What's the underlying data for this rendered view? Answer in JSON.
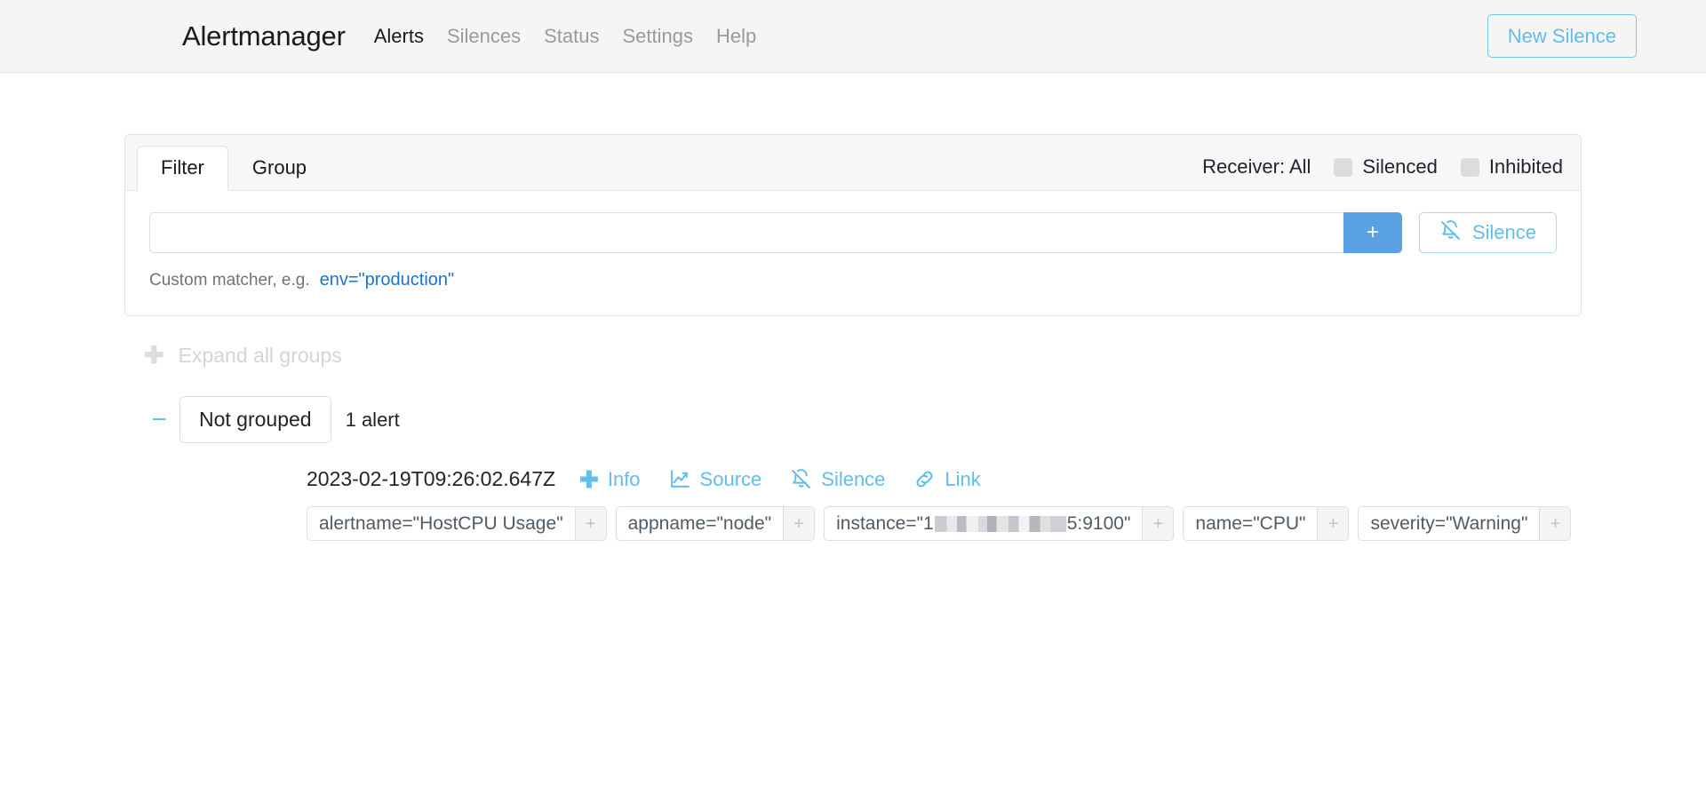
{
  "navbar": {
    "brand": "Alertmanager",
    "links": [
      {
        "label": "Alerts",
        "active": true
      },
      {
        "label": "Silences",
        "active": false
      },
      {
        "label": "Status",
        "active": false
      },
      {
        "label": "Settings",
        "active": false
      },
      {
        "label": "Help",
        "active": false
      }
    ],
    "new_silence_label": "New Silence"
  },
  "filter_card": {
    "tabs": [
      {
        "label": "Filter",
        "active": true
      },
      {
        "label": "Group",
        "active": false
      }
    ],
    "receiver_label": "Receiver: All",
    "checkboxes": [
      {
        "label": "Silenced",
        "checked": false
      },
      {
        "label": "Inhibited",
        "checked": false
      }
    ],
    "matcher_input_value": "",
    "matcher_input_placeholder": "",
    "add_button_label": "+",
    "silence_button_label": "Silence",
    "silence_button_icon": "bell-slash-icon",
    "helper_text": "Custom matcher, e.g.",
    "helper_code": "env=\"production\""
  },
  "expand_all": {
    "icon": "plus-icon",
    "label": "Expand all groups"
  },
  "group": {
    "toggle_icon": "minus-icon",
    "name": "Not grouped",
    "count": "1 alert"
  },
  "alert": {
    "timestamp": "2023-02-19T09:26:02.647Z",
    "actions": [
      {
        "label": "Info",
        "icon": "plus-icon"
      },
      {
        "label": "Source",
        "icon": "chart-line-icon"
      },
      {
        "label": "Silence",
        "icon": "bell-slash-icon"
      },
      {
        "label": "Link",
        "icon": "link-icon"
      }
    ],
    "labels": [
      {
        "text": "alertname=\"HostCPU Usage\"",
        "add": "+",
        "redacted": false
      },
      {
        "text": "appname=\"node\"",
        "add": "+",
        "redacted": false
      },
      {
        "text_prefix": "instance=\"1",
        "text_suffix": "5:9100\"",
        "add": "+",
        "redacted": true
      },
      {
        "text": "name=\"CPU\"",
        "add": "+",
        "redacted": false
      },
      {
        "text": "severity=\"Warning\"",
        "add": "+",
        "redacted": false
      }
    ]
  },
  "colors": {
    "accent_blue": "#61bdec",
    "add_button_blue": "#5aa2e3",
    "code_blue": "#1a73d0",
    "group_toggle": "#5bc8e8",
    "navbar_bg": "#f5f5f5"
  }
}
